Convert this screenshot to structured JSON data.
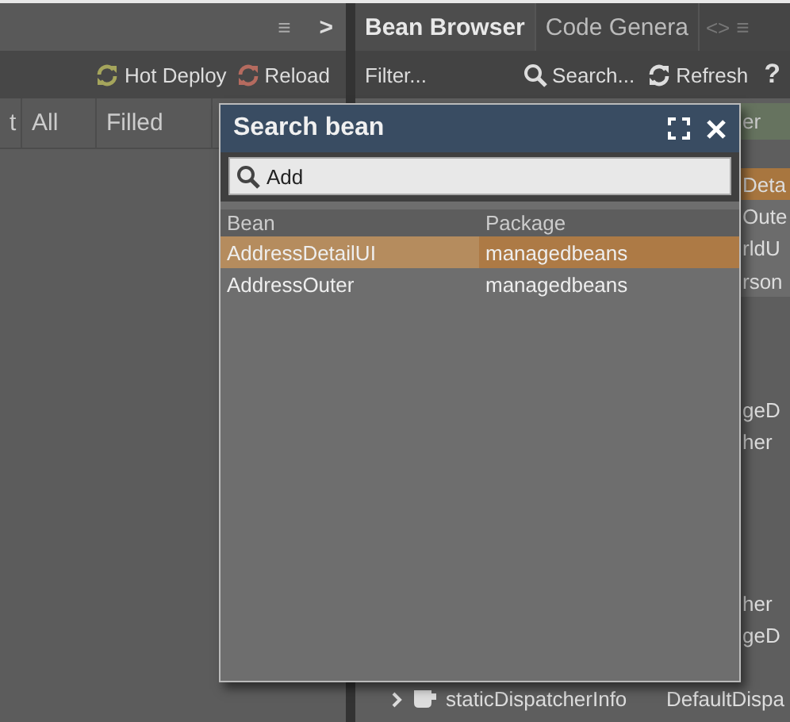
{
  "left_panel": {
    "top_bar": {
      "menu_glyph": "≡",
      "next_glyph": ">"
    },
    "toolbar": [
      {
        "label": "Hot Deploy",
        "kind": "deploy"
      },
      {
        "label": "Reload",
        "kind": "reload"
      }
    ],
    "columns": [
      "t",
      "All",
      "Filled"
    ]
  },
  "right_panel": {
    "tabs": [
      {
        "label": "Bean Browser",
        "selected": true
      },
      {
        "label": "Code Genera",
        "selected": false
      }
    ],
    "tab_nav": "<>",
    "tab_menu": "≡",
    "toolbar": {
      "filter": "Filter...",
      "search": "Search...",
      "refresh": "Refresh",
      "help": "?"
    },
    "header_fragment": "er",
    "rows": [
      {
        "value": "Deta",
        "selected": true
      },
      {
        "value": "Oute",
        "selected": false,
        "matched": true
      },
      {
        "value": "rldU",
        "selected": false,
        "matched": true
      },
      {
        "value": "rson",
        "selected": false,
        "matched": true
      },
      {
        "selected": false,
        "matched": false
      },
      {
        "selected": false,
        "matched": false
      },
      {
        "selected": false,
        "matched": false
      },
      {
        "value": "geD",
        "selected": false,
        "matched": false
      },
      {
        "value": "her",
        "selected": false,
        "matched": false
      },
      {
        "selected": false,
        "matched": false
      },
      {
        "selected": false,
        "matched": false
      },
      {
        "selected": false,
        "matched": false
      },
      {
        "selected": false,
        "matched": false
      },
      {
        "value": "her",
        "selected": false,
        "matched": false
      },
      {
        "value": "geD",
        "selected": false,
        "matched": false
      },
      {
        "selected": false,
        "matched": false
      },
      {
        "name": "staticDispatcherInfo",
        "value": "DefaultDispa",
        "selected": false,
        "matched": false,
        "expanded": false
      }
    ]
  },
  "dialog": {
    "title": "Search bean",
    "search": {
      "value": "Add"
    },
    "columns": [
      "Bean",
      "Package"
    ],
    "rows": [
      {
        "bean": "AddressDetailUI",
        "package": "managedbeans",
        "selected": true
      },
      {
        "bean": "AddressOuter",
        "package": "managedbeans",
        "selected": false
      }
    ]
  }
}
